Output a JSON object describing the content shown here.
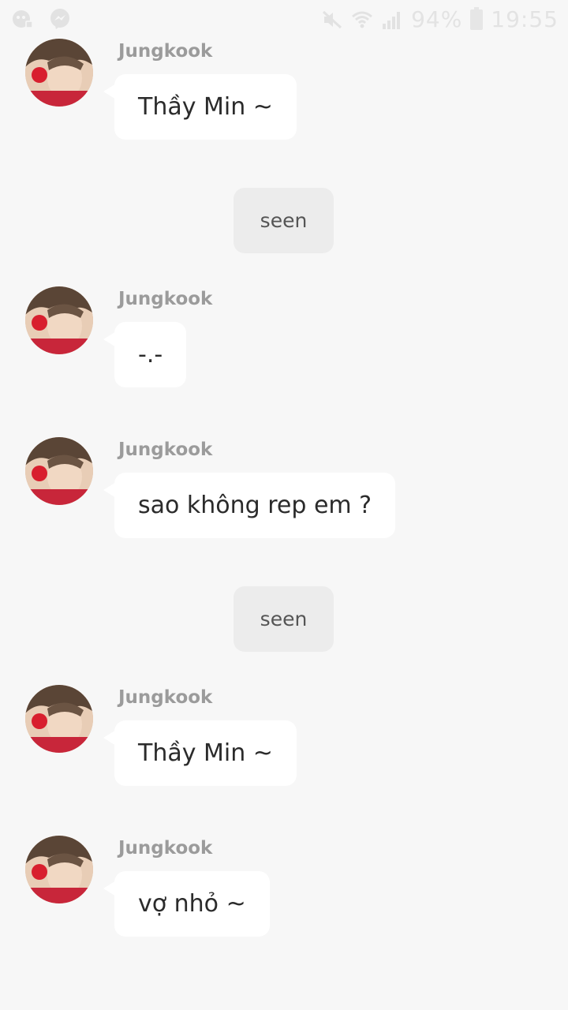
{
  "status_bar": {
    "battery_percent": "94%",
    "time": "19:55",
    "icons": [
      "notification-app-icon",
      "messenger-icon",
      "mute-icon",
      "wifi-icon",
      "signal-icon",
      "battery-icon"
    ]
  },
  "colors": {
    "background": "#f7f7f7",
    "bubble": "#ffffff",
    "seen_bubble": "#ececec",
    "sender_name": "#9b9b9b"
  },
  "messages": [
    {
      "sender": "Jungkook",
      "text": "Thầy Min ~"
    },
    {
      "seen": "seen"
    },
    {
      "sender": "Jungkook",
      "text": "-.-"
    },
    {
      "sender": "Jungkook",
      "text": "sao không rep em ?"
    },
    {
      "seen": "seen"
    },
    {
      "sender": "Jungkook",
      "text": "Thầy Min ~"
    },
    {
      "sender": "Jungkook",
      "text": "vợ nhỏ ~"
    }
  ]
}
